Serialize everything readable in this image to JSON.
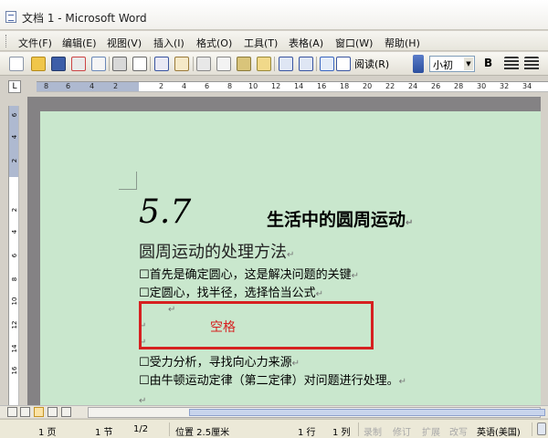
{
  "window": {
    "title": "文档 1 - Microsoft Word"
  },
  "menu": [
    "文件(F)",
    "编辑(E)",
    "视图(V)",
    "插入(I)",
    "格式(O)",
    "工具(T)",
    "表格(A)",
    "窗口(W)",
    "帮助(H)"
  ],
  "toolbar": {
    "reading_label": "阅读(R)",
    "font_size": "小初",
    "bold_label": "B",
    "icons": [
      "new-icon",
      "open-icon",
      "save-icon",
      "permission-icon",
      "email-icon",
      "print-icon",
      "print-preview-icon",
      "spelling-icon",
      "research-icon",
      "cut-icon",
      "copy-icon",
      "paste-icon",
      "format-painter-icon",
      "undo-icon",
      "redo-icon",
      "hyperlink-icon",
      "table-icon",
      "help-icon"
    ]
  },
  "ruler": {
    "corner": "L",
    "numbers": [
      "8",
      "6",
      "4",
      "2",
      "2",
      "4",
      "6",
      "8",
      "10",
      "12",
      "14",
      "16",
      "18",
      "20",
      "22",
      "24",
      "26",
      "28",
      "30",
      "32",
      "34"
    ],
    "vertical_numbers": [
      "6",
      "4",
      "2",
      "2",
      "4",
      "6",
      "8",
      "10",
      "12",
      "14",
      "16"
    ]
  },
  "document": {
    "chapter_number": "5.7",
    "chapter_title": "生活中的圆周运动",
    "section_title": "圆周运动的处理方法",
    "bullets_before": [
      "首先是确定圆心，这是解决问题的关键",
      "定圆心，找半径，选择恰当公式"
    ],
    "annotation": "空格",
    "bullets_after": [
      "受力分析，寻找向心力来源",
      "由牛顿运动定律（第二定律）对问题进行处理。"
    ],
    "paragraph_mark": "↵"
  },
  "statusbar": {
    "page": "1 页",
    "section": "1 节",
    "page_of": "1/2",
    "position": "位置 2.5厘米",
    "line": "1 行",
    "column": "1 列",
    "rec": "录制",
    "trk": "修订",
    "ext": "扩展",
    "ovr": "改写",
    "language": "英语(美国)"
  },
  "colors": {
    "page_background": "#c9e7cd",
    "highlight": "#d62020"
  }
}
